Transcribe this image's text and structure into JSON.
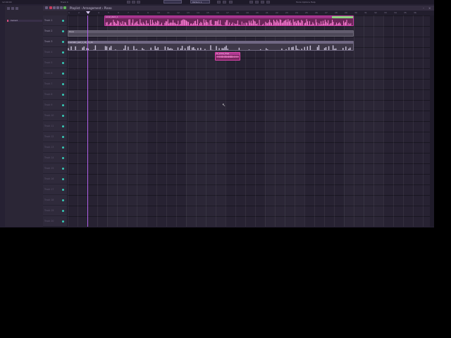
{
  "topbar": {
    "song_label": "Track 4",
    "cpu_label": "12:00:00",
    "info_text": "Tools  Options  Help",
    "pattern_label": "Pattern 1"
  },
  "playlist": {
    "title": "Playlist - Arrangement › Piano",
    "minimize": "–",
    "close": "×"
  },
  "browser": {
    "label": "Current"
  },
  "timeline": {
    "bars": [
      "1",
      "2",
      "3",
      "4",
      "5",
      "6",
      "7",
      "8",
      "9",
      "10",
      "11",
      "12",
      "13",
      "14",
      "15",
      "16",
      "17",
      "18",
      "19",
      "20",
      "21",
      "22",
      "23",
      "24",
      "25",
      "26",
      "27",
      "28",
      "29",
      "30",
      "31",
      "32",
      "33",
      "34",
      "35",
      "36"
    ]
  },
  "tracks": [
    {
      "name": "Track 1"
    },
    {
      "name": "Track 2"
    },
    {
      "name": "Track 3"
    },
    {
      "name": "Track 4"
    },
    {
      "name": "Track 5"
    },
    {
      "name": "Track 6"
    },
    {
      "name": "Track 7"
    },
    {
      "name": "Track 8"
    },
    {
      "name": "Track 9"
    },
    {
      "name": "Track 10"
    },
    {
      "name": "Track 11"
    },
    {
      "name": "Track 12"
    },
    {
      "name": "Track 13"
    },
    {
      "name": "Track 14"
    },
    {
      "name": "Track 15"
    },
    {
      "name": "Track 16"
    },
    {
      "name": "Track 17"
    },
    {
      "name": "Track 18"
    },
    {
      "name": "Track 19"
    },
    {
      "name": "Track 20"
    }
  ],
  "clips": {
    "pink_main": "vocal_stem_1",
    "gray_main": "Piano",
    "light_main": "cinematic_pad_1_14_45_20",
    "small_pink": "fx_vocal_chop"
  },
  "colors": {
    "accent": "#c23aa2",
    "playhead": "#b060e8",
    "led": "#36c9b5"
  }
}
